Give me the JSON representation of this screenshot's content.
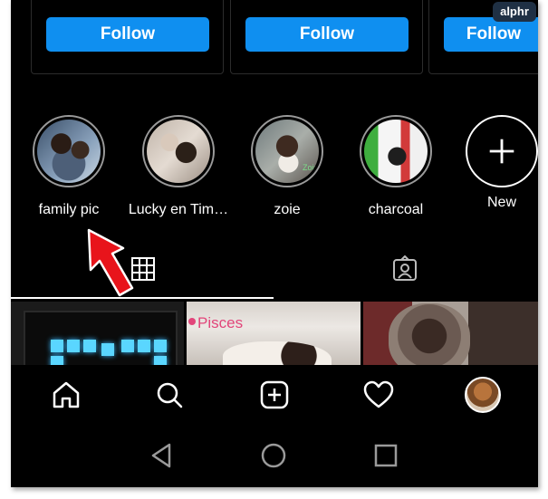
{
  "watermark": "alphr",
  "suggestions": [
    {
      "follow_label": "Follow"
    },
    {
      "follow_label": "Follow"
    },
    {
      "follow_label": "Follow"
    }
  ],
  "highlights": [
    {
      "label": "family pic"
    },
    {
      "label": "Lucky en Tim…"
    },
    {
      "label": "zoie",
      "photo_caption": "Zoie"
    },
    {
      "label": "charcoal"
    }
  ],
  "new_highlight": {
    "label": "New",
    "icon": "plus-icon"
  },
  "tabs": [
    {
      "icon": "grid-icon",
      "selected": true
    },
    {
      "icon": "tagged-person-icon",
      "selected": false
    }
  ],
  "posts": [
    {
      "kind": "led-clock-photo"
    },
    {
      "kind": "dog-photo",
      "caption": "Pisces"
    },
    {
      "kind": "dog-photo"
    }
  ],
  "bottom_nav": [
    {
      "icon": "home-icon"
    },
    {
      "icon": "search-icon"
    },
    {
      "icon": "add-post-icon"
    },
    {
      "icon": "heart-icon"
    },
    {
      "icon": "profile-avatar"
    }
  ],
  "system_nav": [
    {
      "icon": "back-triangle-icon"
    },
    {
      "icon": "home-circle-icon"
    },
    {
      "icon": "recents-square-icon"
    }
  ],
  "colors": {
    "background": "#000000",
    "follow_button": "#0f8ff0",
    "annotation_arrow": "#e8141b",
    "watermark_bg": "#1f3044"
  }
}
